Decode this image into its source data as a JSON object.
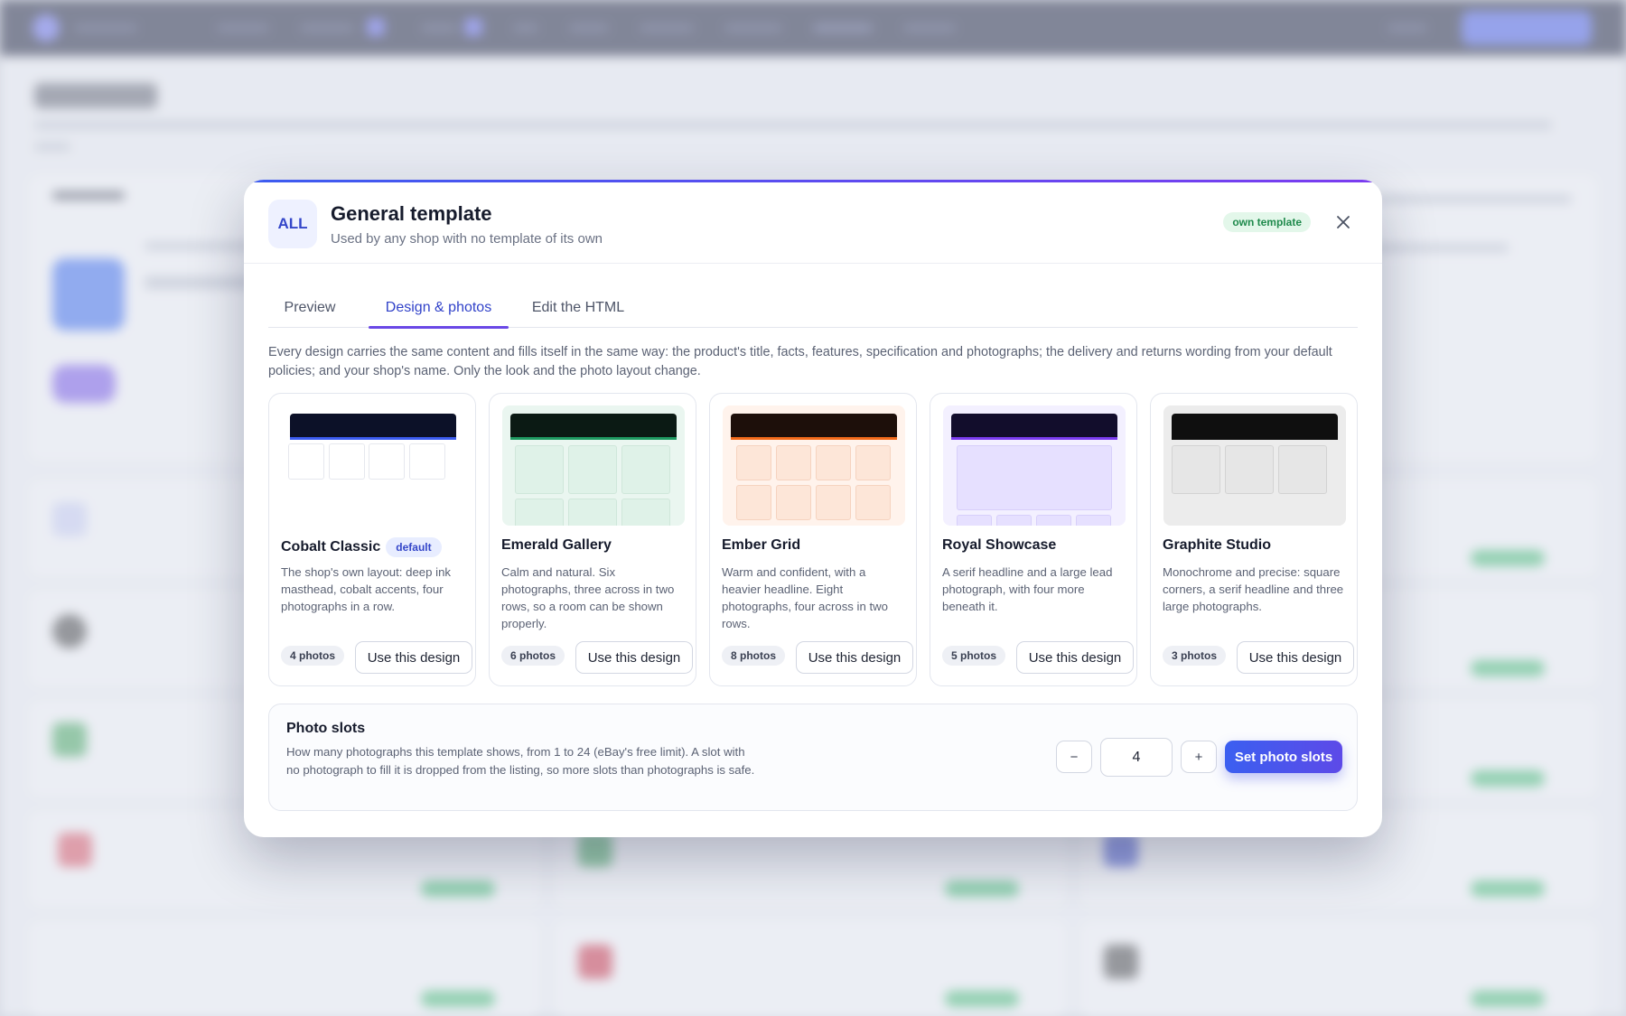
{
  "colors": {
    "accent": "#3b5ff0",
    "accent2": "#6a48e6",
    "ownBadgeBg": "#e3f7ea",
    "ownBadgeText": "#1f8a4c"
  },
  "modal": {
    "scope_badge": "ALL",
    "title": "General template",
    "subtitle": "Used by any shop with no template of its own",
    "status_badge": "own template",
    "close_icon": "close-icon",
    "tabs": [
      {
        "label": "Preview",
        "active": false
      },
      {
        "label": "Design & photos",
        "active": true
      },
      {
        "label": "Edit the HTML",
        "active": false
      }
    ],
    "intro": "Every design carries the same content and fills itself in the same way: the product's title, facts, features, specification and photographs; the delivery and returns wording from your default policies; and your shop's name. Only the look and the photo layout change.",
    "designs": [
      {
        "name": "Cobalt Classic",
        "badge": "default",
        "description": "The shop's own layout: deep ink masthead, cobalt accents, four photographs in a row.",
        "photos": "4 photos",
        "button": "Use this design",
        "colors": {
          "thumbBg": "#ffffff",
          "mast": "#0c1128",
          "accent": "#3c5cf0",
          "cell": "#ffffff",
          "cellBorder": "#e6e8ee"
        }
      },
      {
        "name": "Emerald Gallery",
        "badge": "",
        "description": "Calm and natural. Six photographs, three across in two rows, so a room can be shown properly.",
        "photos": "6 photos",
        "button": "Use this design",
        "colors": {
          "thumbBg": "#eaf6f0",
          "mast": "#0b1a14",
          "accent": "#1f9a62",
          "cell": "#dff2e8",
          "cellBorder": "#cfe7da"
        }
      },
      {
        "name": "Ember Grid",
        "badge": "",
        "description": "Warm and confident, with a heavier headline. Eight photographs, four across in two rows.",
        "photos": "8 photos",
        "button": "Use this design",
        "colors": {
          "thumbBg": "#fff3ec",
          "mast": "#1d0f0a",
          "accent": "#f26a1b",
          "cell": "#fde6d8",
          "cellBorder": "#f6d3bf"
        }
      },
      {
        "name": "Royal Showcase",
        "badge": "",
        "description": "A serif headline and a large lead photograph, with four more beneath it.",
        "photos": "5 photos",
        "button": "Use this design",
        "colors": {
          "thumbBg": "#f3f0ff",
          "mast": "#120d2c",
          "accent": "#7b3cf0",
          "cell": "#e6e0ff",
          "cellBorder": "#d7cffa"
        }
      },
      {
        "name": "Graphite Studio",
        "badge": "",
        "description": "Monochrome and precise: square corners, a serif headline and three large photographs.",
        "photos": "3 photos",
        "button": "Use this design",
        "colors": {
          "thumbBg": "#ececec",
          "mast": "#0f0f0f",
          "accent": "#0f0f0f",
          "cell": "#e6e6e6",
          "cellBorder": "#d3d3d3"
        }
      }
    ],
    "photo_slots": {
      "title": "Photo slots",
      "description": "How many photographs this template shows, from 1 to 24 (eBay's free limit). A slot with no photograph to fill it is dropped from the listing, so more slots than photographs is safe.",
      "minus": "−",
      "value": "4",
      "plus": "+",
      "button": "Set photo slots"
    }
  }
}
